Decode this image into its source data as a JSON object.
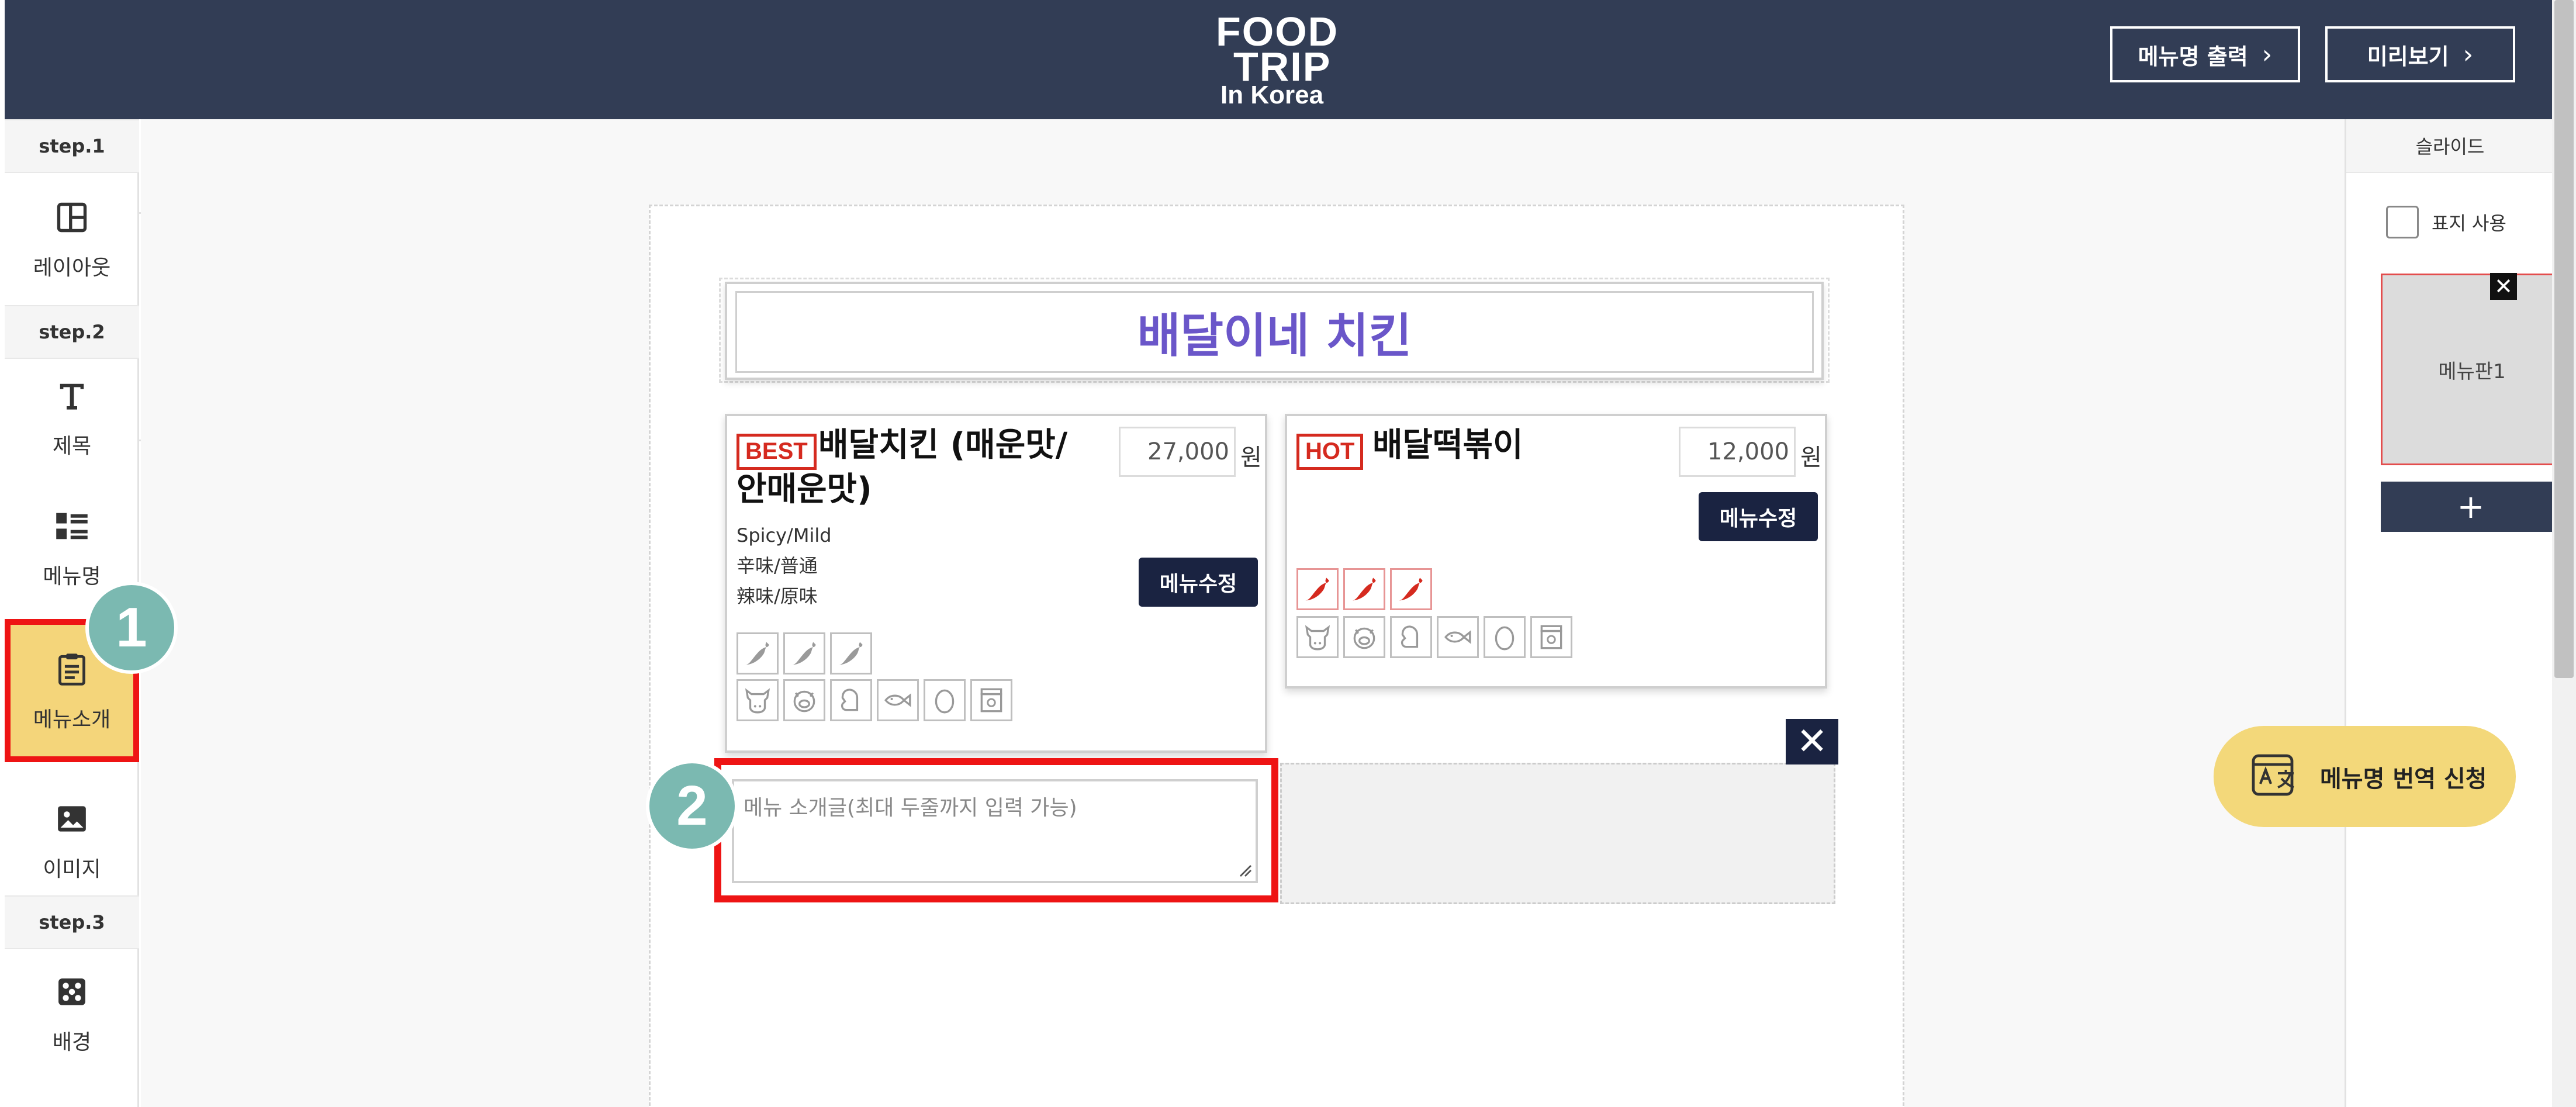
{
  "header": {
    "logo_line1": "FOOD",
    "logo_line2": "TRIP",
    "logo_line3": "In Korea",
    "print_button": "메뉴명 출력",
    "preview_button": "미리보기"
  },
  "sidebar": {
    "step1": "step.1",
    "step2": "step.2",
    "step3": "step.3",
    "items": [
      {
        "label": "레이아웃",
        "icon": "layout-icon"
      },
      {
        "label": "제목",
        "icon": "text-icon"
      },
      {
        "label": "메뉴명",
        "icon": "menu-list-icon"
      },
      {
        "label": "메뉴소개",
        "icon": "clipboard-icon",
        "active": true
      },
      {
        "label": "이미지",
        "icon": "image-icon"
      },
      {
        "label": "배경",
        "icon": "pattern-icon"
      }
    ]
  },
  "board": {
    "title": "배달이네 치킨",
    "cards": [
      {
        "badge": "BEST",
        "name": "배달치킨 (매운맛/ 안매운맛)",
        "price": "27,000",
        "currency": "원",
        "description": [
          "Spicy/Mild",
          "辛味/普通",
          "辣味/原味"
        ],
        "edit_label": "메뉴수정"
      },
      {
        "badge": "HOT",
        "name": "배달떡볶이",
        "price": "12,000",
        "currency": "원",
        "edit_label": "메뉴수정"
      }
    ],
    "intro_placeholder": "메뉴 소개글(최대 두줄까지 입력 가능)",
    "close_label": "✕"
  },
  "callouts": {
    "one": "1",
    "two": "2"
  },
  "right_panel": {
    "header": "슬라이드",
    "checkbox_label": "표지 사용",
    "slide_label": "메뉴판1",
    "slide_close": "✕",
    "add_label": "+"
  },
  "translate_button": "메뉴명 번역 신청",
  "colors": {
    "header_bg": "#323d55",
    "active_bg": "#f4d57a",
    "highlight": "#ee1414",
    "title_text": "#6a56c9",
    "badge_red": "#d52a1f",
    "button_navy": "#1a2341",
    "callout_teal": "#7bb9b1",
    "translate_bg": "#f3d87a"
  }
}
